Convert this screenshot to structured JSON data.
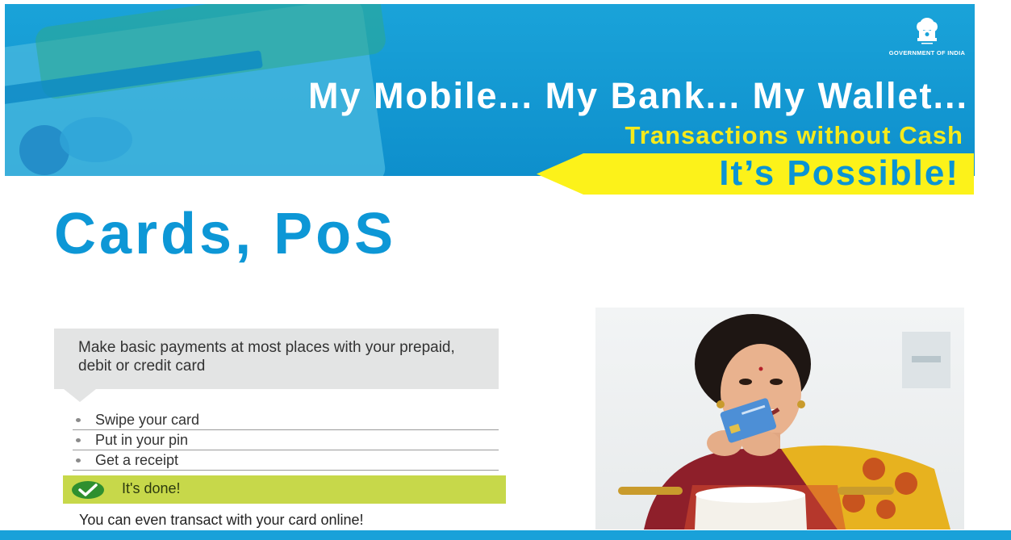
{
  "banner": {
    "emblem_caption": "GOVERNMENT OF INDIA",
    "headline": "My Mobile... My Bank... My Wallet...",
    "subheadline": "Transactions without Cash",
    "tagline": "It’s Possible!",
    "colors": {
      "banner_blue": "#1aa3d9",
      "yellow": "#fcf21a",
      "white": "#ffffff"
    }
  },
  "main": {
    "title": "Cards, PoS",
    "title_color": "#0d97d6"
  },
  "info": {
    "description": "Make basic payments at most places with your prepaid, debit or credit card",
    "steps": [
      "Swipe your card",
      "Put in your pin",
      "Get a receipt"
    ],
    "done_label": "It's done!",
    "done_icon": "checkmark-circle-icon",
    "done_color": "#c7d84a",
    "online_note": "You can even transact with your card online!"
  },
  "photo": {
    "subject": "woman-holding-card-photo"
  }
}
